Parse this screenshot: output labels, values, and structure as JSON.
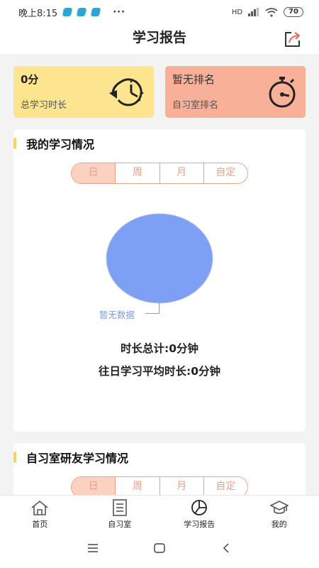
{
  "status_bar": {
    "time": "晚上8:15",
    "more": "···",
    "network": "HD",
    "battery": "70"
  },
  "header": {
    "title": "学习报告",
    "share_icon": "share-icon"
  },
  "stats": {
    "total_time_value": "0分",
    "total_time_label": "总学习时长",
    "rank_value": "暂无排名",
    "rank_label": "自习室排名",
    "total_time_icon": "clock-rewind-icon",
    "rank_icon": "stopwatch-icon"
  },
  "my_study": {
    "title": "我的学习情况",
    "tabs": [
      "日",
      "周",
      "月",
      "自定"
    ],
    "active_tab": "日",
    "chart_data": {
      "type": "pie",
      "slices": [],
      "empty_label": "暂无数据",
      "color": "#7da0f5"
    },
    "total_duration": "时长总计:0分钟",
    "avg_duration": "往日学习平均时长:0分钟"
  },
  "friends_study": {
    "title": "自习室研友学习情况",
    "tabs": [
      "日",
      "周",
      "月",
      "自定"
    ],
    "active_tab": "日"
  },
  "bottom_nav": {
    "items": [
      {
        "label": "首页",
        "icon": "home-icon"
      },
      {
        "label": "自习室",
        "icon": "notebook-icon"
      },
      {
        "label": "学习报告",
        "icon": "pie-chart-icon"
      },
      {
        "label": "我的",
        "icon": "graduation-cap-icon"
      }
    ]
  },
  "colors": {
    "yellow_card": "#fde58f",
    "salmon_card": "#f8b098",
    "accent_orange": "#ef9f86",
    "pie_blue": "#7da0f5"
  }
}
